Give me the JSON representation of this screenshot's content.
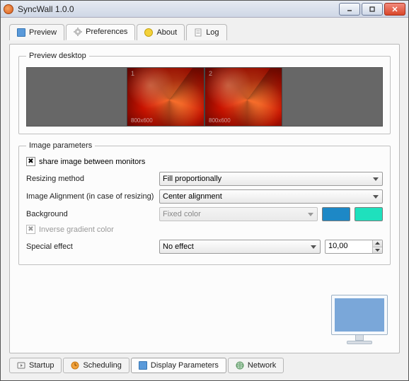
{
  "window": {
    "title": "SyncWall 1.0.0"
  },
  "tabs": {
    "preview": "Preview",
    "preferences": "Preferences",
    "about": "About",
    "log": "Log"
  },
  "preview_group": {
    "legend": "Preview  desktop",
    "monitor1_num": "1",
    "monitor1_res": "800x600",
    "monitor2_num": "2",
    "monitor2_res": "800x600"
  },
  "params": {
    "legend": "Image parameters",
    "share_label": "share image between monitors",
    "resizing_label": "Resizing method",
    "resizing_value": "Fill proportionally",
    "alignment_label": "Image Alignment (in case of resizing)",
    "alignment_value": "Center alignment",
    "background_label": "Background",
    "background_value": "Fixed color",
    "bg_color1": "#1d88c6",
    "bg_color2": "#1fe0bd",
    "inverse_label": "Inverse gradient color",
    "special_label": "Special effect",
    "special_value": "No effect",
    "spin_value": "10,00"
  },
  "bottom_tabs": {
    "startup": "Startup",
    "scheduling": "Scheduling",
    "display": "Display Parameters",
    "network": "Network"
  }
}
